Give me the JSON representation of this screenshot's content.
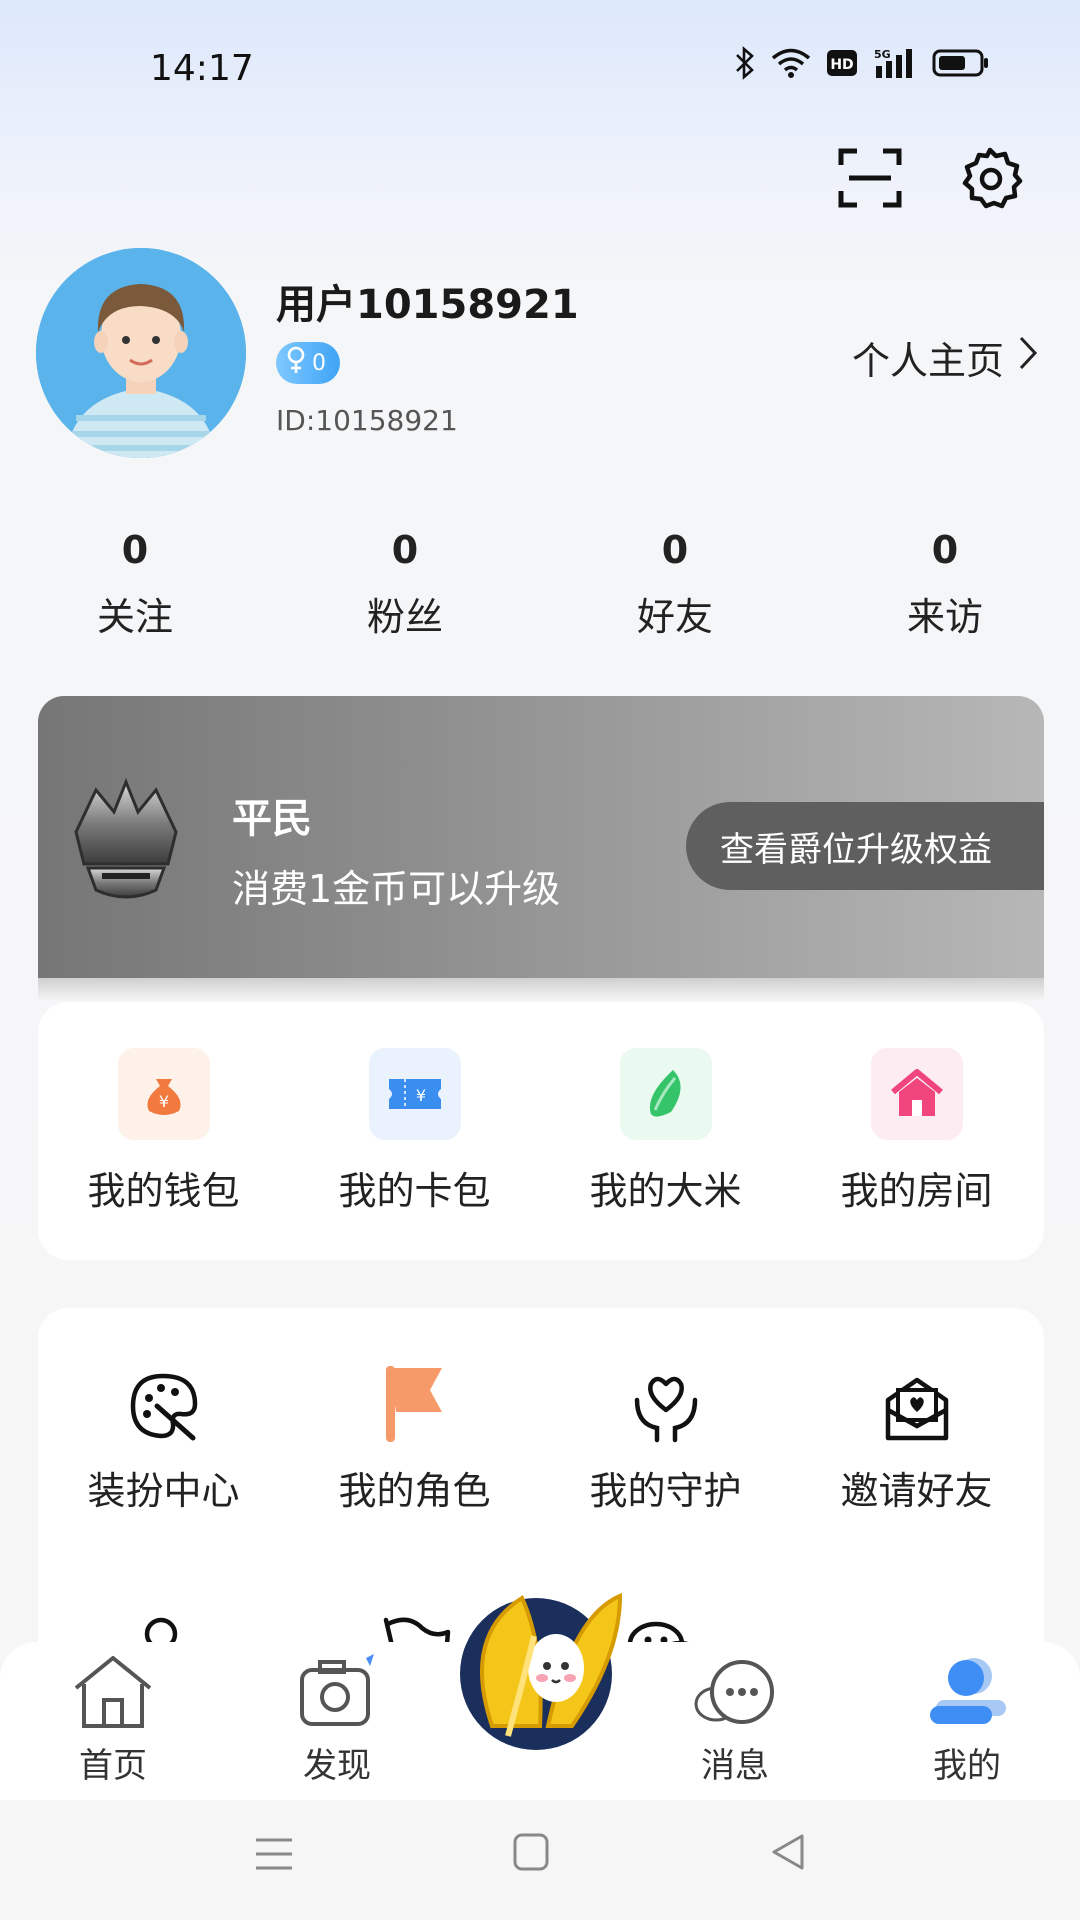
{
  "status_bar": {
    "time": "14:17",
    "hd_label": "HD",
    "network_label": "5G"
  },
  "header": {
    "scan_icon": "scan-icon",
    "settings_icon": "gear-icon"
  },
  "profile": {
    "username": "用户10158921",
    "gender_count": "0",
    "user_id": "ID:10158921",
    "homepage_link": "个人主页"
  },
  "stats": [
    {
      "value": "0",
      "label": "关注"
    },
    {
      "value": "0",
      "label": "粉丝"
    },
    {
      "value": "0",
      "label": "好友"
    },
    {
      "value": "0",
      "label": "来访"
    }
  ],
  "rank": {
    "title": "平民",
    "subtitle": "消费1金币可以升级",
    "button": "查看爵位升级权益"
  },
  "quick_items": [
    {
      "label": "我的钱包",
      "icon": "wallet-icon"
    },
    {
      "label": "我的卡包",
      "icon": "ticket-icon"
    },
    {
      "label": "我的大米",
      "icon": "rice-icon"
    },
    {
      "label": "我的房间",
      "icon": "house-icon"
    }
  ],
  "features": [
    {
      "label": "装扮中心",
      "icon": "palette-icon"
    },
    {
      "label": "我的角色",
      "icon": "flag-icon"
    },
    {
      "label": "我的守护",
      "icon": "heart-hands-icon"
    },
    {
      "label": "邀请好友",
      "icon": "envelope-icon"
    }
  ],
  "features_row2_icons": [
    "user-check-icon",
    "flag-outline-icon",
    "wechat-icon"
  ],
  "bottom_nav": [
    {
      "label": "首页",
      "icon": "home-icon"
    },
    {
      "label": "发现",
      "icon": "camera-icon"
    },
    {
      "label": "消息",
      "icon": "chat-icon"
    },
    {
      "label": "我的",
      "icon": "profile-icon",
      "active": true
    }
  ],
  "colors": {
    "accent": "#3f8ef5",
    "rank_bg": "#8f8f8f",
    "wallet": "#f27a3e",
    "ticket": "#3a8ef0",
    "rice": "#35c46a",
    "house": "#f0457d",
    "flag": "#f79a6a"
  }
}
